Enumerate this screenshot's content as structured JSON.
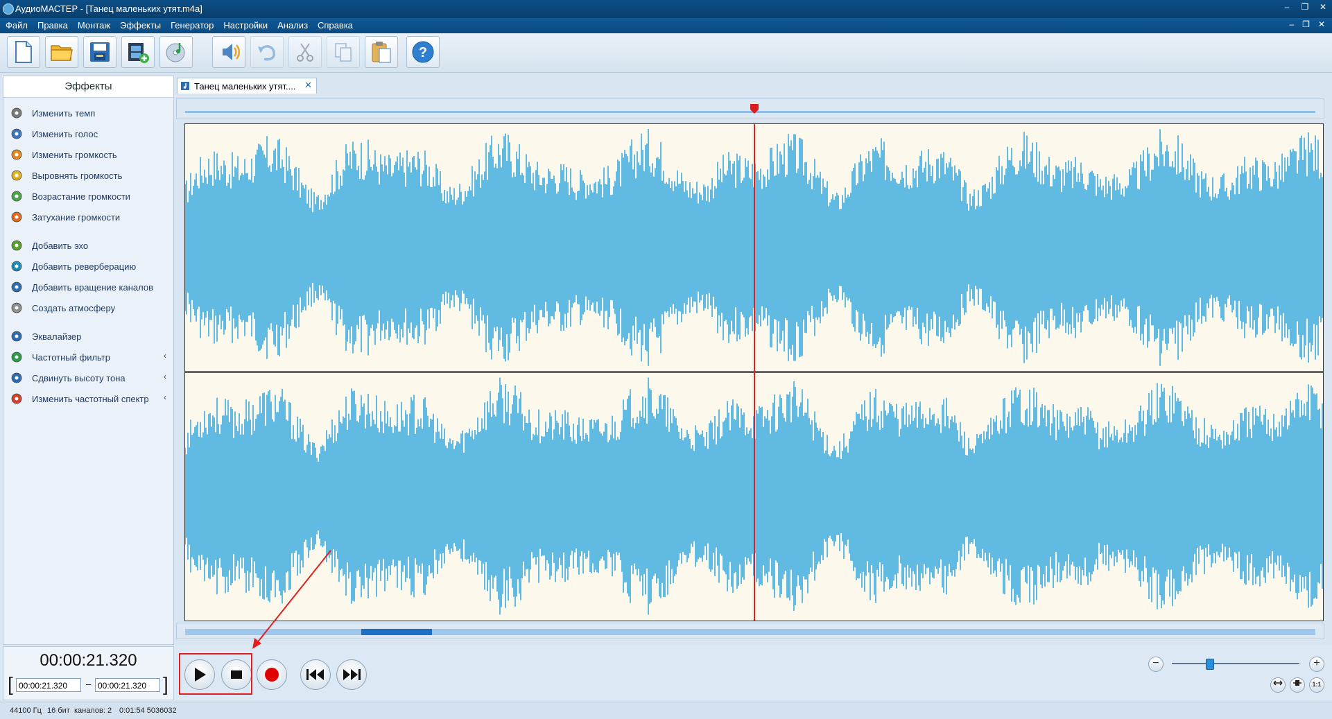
{
  "window": {
    "title": "АудиоМАСТЕР - [Танец маленьких утят.m4a]",
    "minimize": "–",
    "restore": "❐",
    "close": "✕"
  },
  "menu": {
    "items": [
      "Файл",
      "Правка",
      "Монтаж",
      "Эффекты",
      "Генератор",
      "Настройки",
      "Анализ",
      "Справка"
    ],
    "right_minimize": "–",
    "right_restore": "❐",
    "right_close": "✕"
  },
  "toolbar": {
    "buttons": [
      "new-file",
      "open-folder",
      "save",
      "add-video",
      "add-cd",
      "speaker",
      "undo",
      "cut",
      "copy",
      "paste",
      "help"
    ]
  },
  "sidebar": {
    "header": "Эффекты",
    "items": [
      {
        "label": "Изменить темп",
        "icon": "clock-icon"
      },
      {
        "label": "Изменить голос",
        "icon": "voice-icon"
      },
      {
        "label": "Изменить громкость",
        "icon": "volume-icon"
      },
      {
        "label": "Выровнять громкость",
        "icon": "normalize-icon"
      },
      {
        "label": "Возрастание громкости",
        "icon": "fade-in-icon"
      },
      {
        "label": "Затухание громкости",
        "icon": "fade-out-icon"
      },
      {
        "label": "Добавить эхо",
        "icon": "echo-icon"
      },
      {
        "label": "Добавить реверберацию",
        "icon": "reverb-icon"
      },
      {
        "label": "Добавить вращение каналов",
        "icon": "rotate-channels-icon"
      },
      {
        "label": "Создать атмосферу",
        "icon": "atmosphere-icon"
      },
      {
        "label": "Эквалайзер",
        "icon": "equalizer-icon"
      },
      {
        "label": "Частотный фильтр",
        "icon": "filter-icon"
      },
      {
        "label": "Сдвинуть высоту тона",
        "icon": "pitch-icon"
      },
      {
        "label": "Изменить частотный спектр",
        "icon": "spectrum-icon"
      }
    ],
    "chevron": "‹"
  },
  "document_tab": {
    "label": "Танец маленьких утят....",
    "close": "✕"
  },
  "playback": {
    "current_time": "00:00:21.320",
    "selection_start": "00:00:21.320",
    "selection_end": "00:00:21.320",
    "dash": "–"
  },
  "zoom": {
    "minus": "−",
    "plus": "+",
    "fit_label": "1:1"
  },
  "status": {
    "sample_rate": "44100 Гц",
    "bit_depth": "16 бит",
    "channels": "каналов: 2",
    "duration": "0:01:54 5036032"
  },
  "colors": {
    "waveform": "#1e9fdc",
    "waveform_bg": "#fdf8ec",
    "playhead": "#e02020",
    "highlight_box": "#e02020"
  }
}
